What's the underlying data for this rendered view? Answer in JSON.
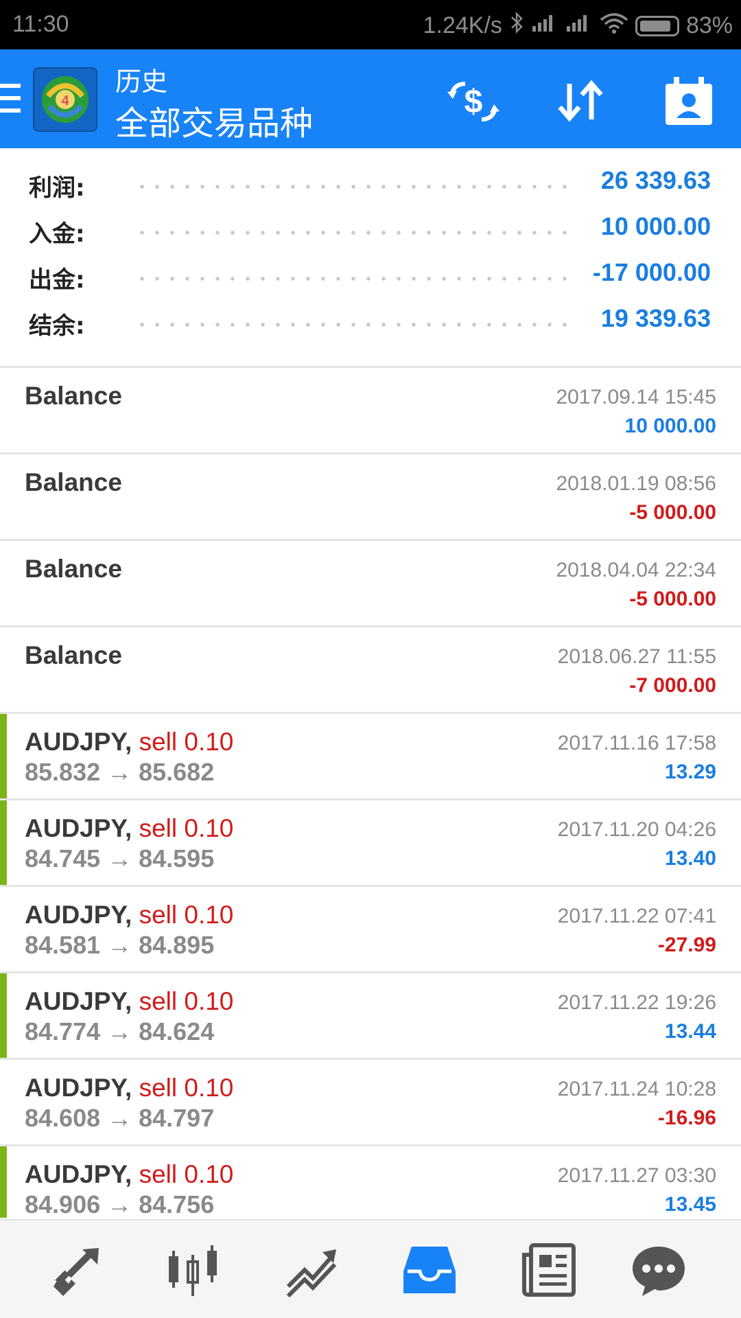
{
  "status_bar": {
    "time": "11:30",
    "net_speed": "1.24K/s",
    "battery": "83%"
  },
  "header": {
    "title": "历史",
    "subtitle": "全部交易品种",
    "icons": [
      "menu-icon",
      "app-logo",
      "currency-exchange-icon",
      "sort-icon",
      "calendar-contact-icon"
    ]
  },
  "summary": [
    {
      "label": "利润:",
      "value": "26 339.63"
    },
    {
      "label": "入金:",
      "value": "10 000.00"
    },
    {
      "label": "出金:",
      "value": "-17 000.00"
    },
    {
      "label": "结余:",
      "value": "19 339.63"
    }
  ],
  "rows": [
    {
      "name": "Balance",
      "date": "2017.09.14 15:45",
      "amount": "10 000.00",
      "positive": true
    },
    {
      "name": "Balance",
      "date": "2018.01.19 08:56",
      "amount": "-5 000.00",
      "positive": false
    },
    {
      "name": "Balance",
      "date": "2018.04.04 22:34",
      "amount": "-5 000.00",
      "positive": false
    },
    {
      "name": "Balance",
      "date": "2018.06.27 11:55",
      "amount": "-7 000.00",
      "positive": false
    },
    {
      "name": "AUDJPY,",
      "side": "sell 0.10",
      "prices": "85.832 → 85.682",
      "date": "2017.11.16 17:58",
      "amount": "13.29",
      "positive": true
    },
    {
      "name": "AUDJPY,",
      "side": "sell 0.10",
      "prices": "84.745 → 84.595",
      "date": "2017.11.20 04:26",
      "amount": "13.40",
      "positive": true
    },
    {
      "name": "AUDJPY,",
      "side": "sell 0.10",
      "prices": "84.581 → 84.895",
      "date": "2017.11.22 07:41",
      "amount": "-27.99",
      "positive": false
    },
    {
      "name": "AUDJPY,",
      "side": "sell 0.10",
      "prices": "84.774 → 84.624",
      "date": "2017.11.22 19:26",
      "amount": "13.44",
      "positive": true
    },
    {
      "name": "AUDJPY,",
      "side": "sell 0.10",
      "prices": "84.608 → 84.797",
      "date": "2017.11.24 10:28",
      "amount": "-16.96",
      "positive": false
    },
    {
      "name": "AUDJPY,",
      "side": "sell 0.10",
      "prices": "84.906 → 84.756",
      "date": "2017.11.27 03:30",
      "amount": "13.45",
      "positive": true
    }
  ],
  "bottom_nav": [
    {
      "icon": "quotes-arrows-icon",
      "active": false
    },
    {
      "icon": "chart-candles-icon",
      "active": false
    },
    {
      "icon": "trade-icon",
      "active": false
    },
    {
      "icon": "history-inbox-icon",
      "active": true
    },
    {
      "icon": "news-icon",
      "active": false
    },
    {
      "icon": "chat-icon",
      "active": false
    }
  ],
  "colors": {
    "accent_blue": "#1883f6",
    "positive": "#1a7ee0",
    "negative": "#d11b1b",
    "profit_bar": "#7cb518"
  }
}
